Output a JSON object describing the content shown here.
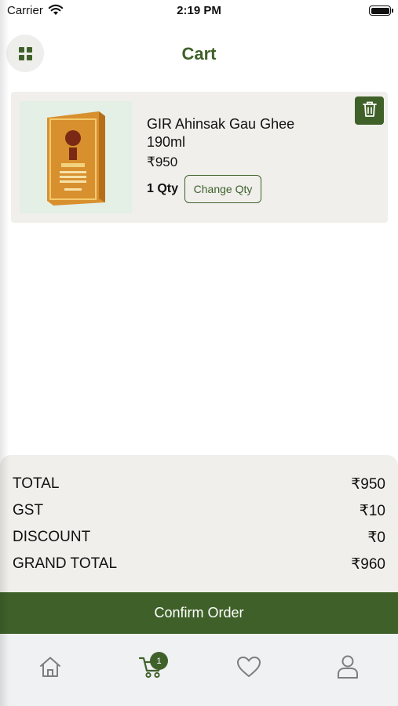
{
  "status_bar": {
    "carrier": "Carrier",
    "time": "2:19 PM"
  },
  "header": {
    "title": "Cart",
    "menu_icon": "grid-icon"
  },
  "cart": {
    "items": [
      {
        "name": "GIR Ahinsak Gau Ghee 190ml",
        "price": "₹950",
        "quantity": "1 Qty",
        "change_qty_label": "Change Qty",
        "delete_icon": "trash-icon"
      }
    ]
  },
  "summary": {
    "rows": [
      {
        "label": "TOTAL",
        "value": "₹950"
      },
      {
        "label": "GST",
        "value": "₹10"
      },
      {
        "label": "DISCOUNT",
        "value": "₹0"
      },
      {
        "label": "GRAND TOTAL",
        "value": "₹960"
      }
    ]
  },
  "confirm_label": "Confirm Order",
  "tab_bar": {
    "tabs": [
      "home-icon",
      "cart-icon",
      "heart-icon",
      "user-icon"
    ],
    "active": "cart-icon",
    "cart_badge": "1"
  },
  "colors": {
    "brand": "#3f6129",
    "surface": "#f0efec",
    "tab_bar": "#eff1f2"
  }
}
